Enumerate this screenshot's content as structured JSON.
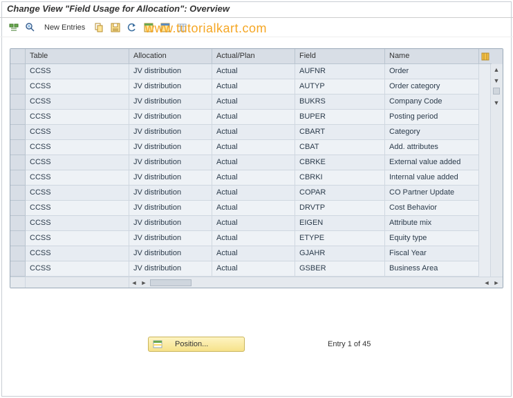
{
  "title": "Change View \"Field Usage for Allocation\": Overview",
  "watermark": "www.tutorialkart.com",
  "toolbar": {
    "new_entries": "New Entries"
  },
  "columns": {
    "table": "Table",
    "allocation": "Allocation",
    "actual_plan": "Actual/Plan",
    "field": "Field",
    "name": "Name"
  },
  "rows": [
    {
      "table": "CCSS",
      "allocation": "JV distribution",
      "actual_plan": "Actual",
      "field": "AUFNR",
      "name": "Order"
    },
    {
      "table": "CCSS",
      "allocation": "JV distribution",
      "actual_plan": "Actual",
      "field": "AUTYP",
      "name": "Order category"
    },
    {
      "table": "CCSS",
      "allocation": "JV distribution",
      "actual_plan": "Actual",
      "field": "BUKRS",
      "name": "Company Code"
    },
    {
      "table": "CCSS",
      "allocation": "JV distribution",
      "actual_plan": "Actual",
      "field": "BUPER",
      "name": "Posting period"
    },
    {
      "table": "CCSS",
      "allocation": "JV distribution",
      "actual_plan": "Actual",
      "field": "CBART",
      "name": "Category"
    },
    {
      "table": "CCSS",
      "allocation": "JV distribution",
      "actual_plan": "Actual",
      "field": "CBAT",
      "name": "Add. attributes"
    },
    {
      "table": "CCSS",
      "allocation": "JV distribution",
      "actual_plan": "Actual",
      "field": "CBRKE",
      "name": "External value added"
    },
    {
      "table": "CCSS",
      "allocation": "JV distribution",
      "actual_plan": "Actual",
      "field": "CBRKI",
      "name": "Internal value added"
    },
    {
      "table": "CCSS",
      "allocation": "JV distribution",
      "actual_plan": "Actual",
      "field": "COPAR",
      "name": "CO Partner Update"
    },
    {
      "table": "CCSS",
      "allocation": "JV distribution",
      "actual_plan": "Actual",
      "field": "DRVTP",
      "name": "Cost Behavior"
    },
    {
      "table": "CCSS",
      "allocation": "JV distribution",
      "actual_plan": "Actual",
      "field": "EIGEN",
      "name": "Attribute mix"
    },
    {
      "table": "CCSS",
      "allocation": "JV distribution",
      "actual_plan": "Actual",
      "field": "ETYPE",
      "name": "Equity type"
    },
    {
      "table": "CCSS",
      "allocation": "JV distribution",
      "actual_plan": "Actual",
      "field": "GJAHR",
      "name": "Fiscal Year"
    },
    {
      "table": "CCSS",
      "allocation": "JV distribution",
      "actual_plan": "Actual",
      "field": "GSBER",
      "name": "Business Area"
    }
  ],
  "position": {
    "label": "Position...",
    "status": "Entry 1 of 45"
  }
}
